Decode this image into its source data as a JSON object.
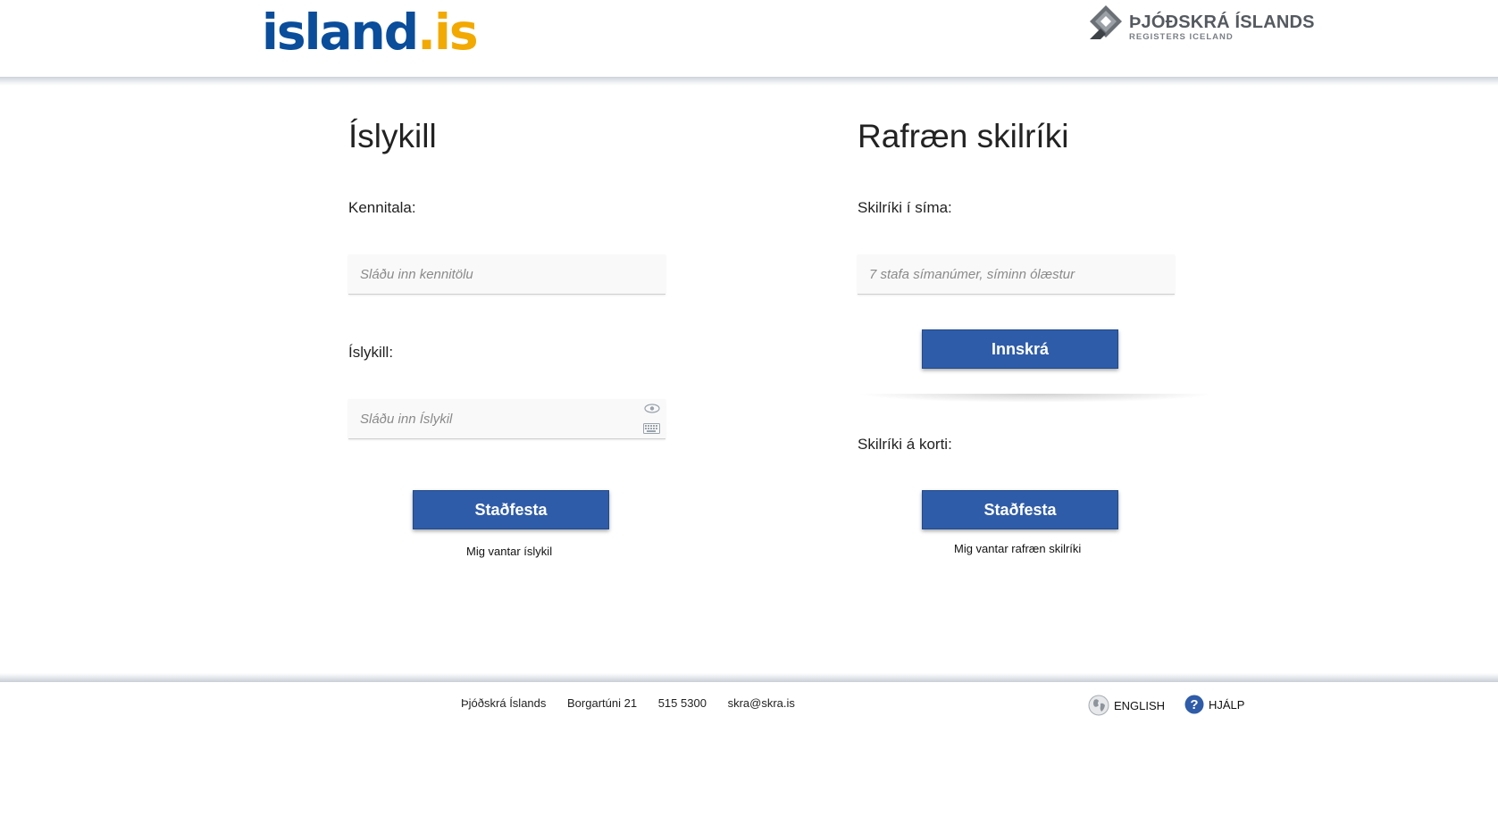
{
  "header": {
    "logo_main": "island",
    "logo_dot": ".",
    "logo_suffix": "is",
    "agency_name": "ÞJÓÐSKRÁ ÍSLANDS",
    "agency_subtitle": "REGISTERS ICELAND"
  },
  "left": {
    "title": "Íslykill",
    "id_label": "Kennitala:",
    "id_placeholder": "Sláðu inn kennitölu",
    "key_label": "Íslykill:",
    "key_placeholder": "Sláðu inn Íslykil",
    "submit_label": "Staðfesta",
    "help_link": "Mig vantar íslykil"
  },
  "right": {
    "title": "Rafræn skilríki",
    "phone_label": "Skilríki í síma:",
    "phone_placeholder": "7 stafa símanúmer, síminn ólæstur",
    "login_label": "Innskrá",
    "card_label": "Skilríki á korti:",
    "card_submit_label": "Staðfesta",
    "help_link": "Mig vantar rafræn skilríki"
  },
  "footer": {
    "org": "Þjóðskrá Íslands",
    "address": "Borgartúni 21",
    "phone": "515 5300",
    "email": "skra@skra.is",
    "english_label": "English",
    "help_label": "Hjálp"
  },
  "colors": {
    "primary_button": "#2f5ca8",
    "logo_blue": "#0a4d9b",
    "logo_orange": "#f2a900"
  }
}
